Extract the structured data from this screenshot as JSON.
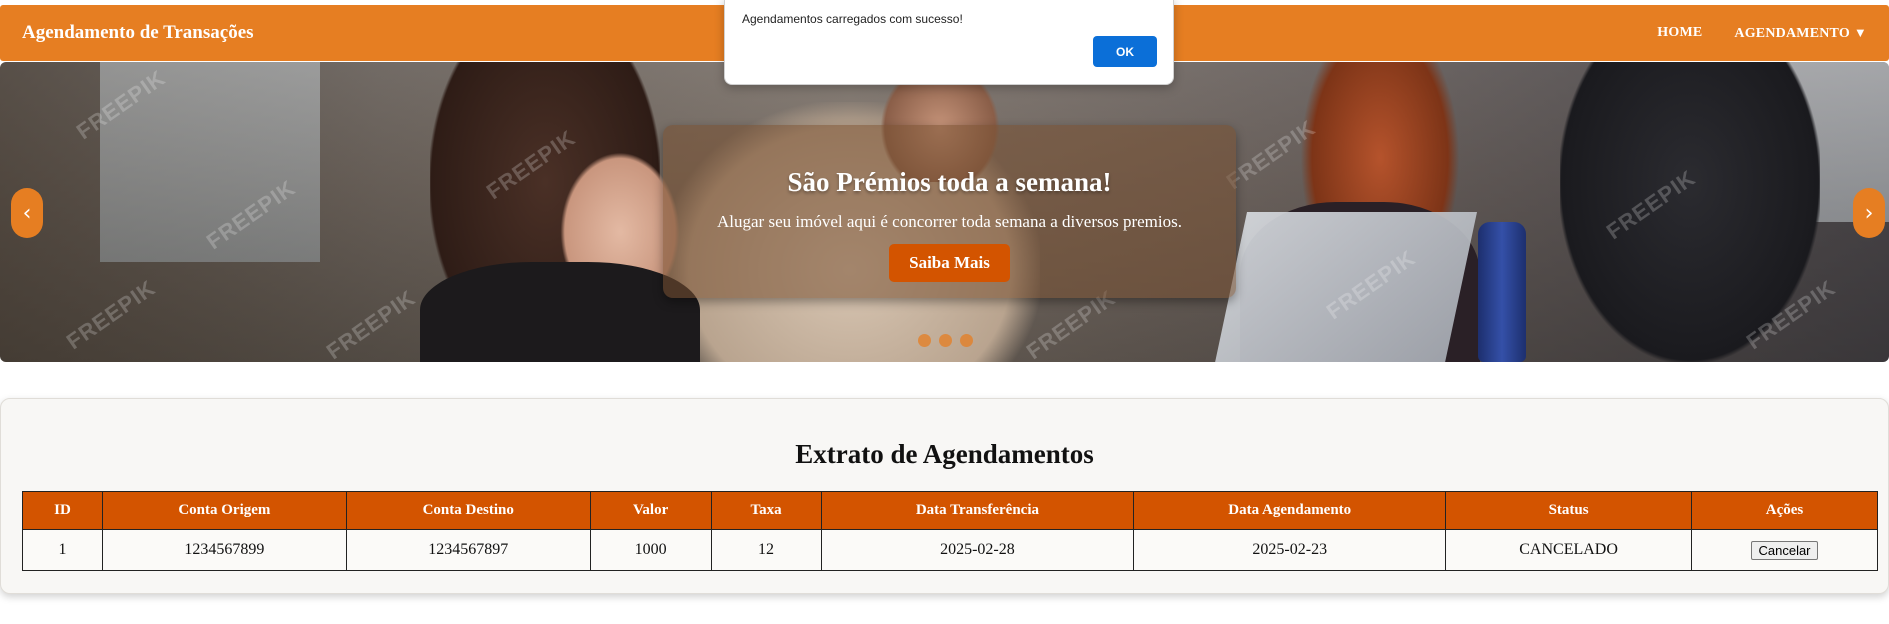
{
  "navbar": {
    "brand": "Agendamento de Transações",
    "links": [
      {
        "label": "HOME"
      },
      {
        "label": "AGENDAMENTO",
        "caret": "▼"
      }
    ],
    "color": "#e67e22"
  },
  "hero": {
    "title": "São Prémios toda a semana!",
    "text": "Alugar seu imóvel aqui é concorrer toda semana a diversos premios.",
    "button": "Saiba Mais",
    "prev_icon": "‹",
    "next_icon": "›",
    "slides": 3,
    "watermark": "FREEPIK"
  },
  "alert": {
    "message": "Agendamentos carregados com sucesso!",
    "ok": "OK"
  },
  "extrato": {
    "title": "Extrato de Agendamentos",
    "columns": [
      "ID",
      "Conta Origem",
      "Conta Destino",
      "Valor",
      "Taxa",
      "Data Transferência",
      "Data Agendamento",
      "Status",
      "Ações"
    ],
    "rows": [
      {
        "id": "1",
        "conta_origem": "1234567899",
        "conta_destino": "1234567897",
        "valor": "1000",
        "taxa": "12",
        "data_transferencia": "2025-02-28",
        "data_agendamento": "2025-02-23",
        "status": "CANCELADO",
        "acao": "Cancelar"
      }
    ],
    "header_color": "#d35400"
  }
}
